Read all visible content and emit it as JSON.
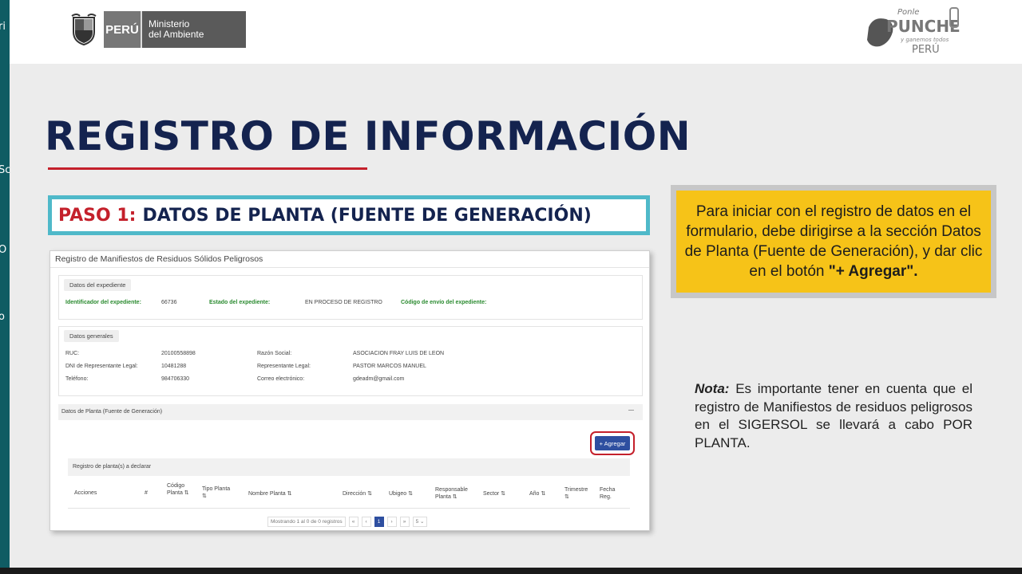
{
  "left_strip": {
    "chars": [
      "ri",
      "Sc",
      "O",
      "o"
    ]
  },
  "header": {
    "minam_country": "PERÚ",
    "minam_name_line1": "Ministerio",
    "minam_name_line2": "del Ambiente",
    "brand_logo_text_1": "Ponle",
    "brand_logo_text_2": "PUNCHE",
    "brand_logo_text_3": "y ganemos todos",
    "brand_logo_text_4": "PERÚ"
  },
  "slide": {
    "title": "REGISTRO DE INFORMACIÓN",
    "paso_prefix": "PASO 1:",
    "paso_text": "DATOS DE PLANTA (FUENTE DE GENERACIÓN)",
    "info_line1": "Para iniciar con el registro de datos en el formulario, debe dirigirse a la sección Datos de Planta (Fuente de Generación), y dar clic en el botón",
    "info_bold": "\"+ Agregar\".",
    "note_label": "Nota:",
    "note_text": "Es importante tener en cuenta que el registro de Manifiestos de residuos peligrosos en el SIGERSOL se llevará a cabo POR PLANTA."
  },
  "screenshot": {
    "title": "Registro de Manifiestos de Residuos Sólidos Peligrosos",
    "expediente": {
      "chip": "Datos del expediente",
      "id_label": "Identificador del expediente:",
      "id_value": "66736",
      "estado_label": "Estado del expediente:",
      "estado_value": "EN PROCESO DE REGISTRO",
      "codigo_label": "Código de envío del expediente:"
    },
    "generales": {
      "chip": "Datos generales",
      "ruc_label": "RUC:",
      "ruc_value": "20100558898",
      "razon_label": "Razón Social:",
      "razon_value": "ASOCIACION FRAY LUIS DE LEON",
      "dni_label": "DNI de Representante Legal:",
      "dni_value": "10481288",
      "rep_label": "Representante Legal:",
      "rep_value": "PASTOR MARCOS MANUEL",
      "tel_label": "Teléfono:",
      "tel_value": "984706330",
      "correo_label": "Correo electrónico:",
      "correo_value": "gdeadm@gmail.com"
    },
    "planta": {
      "header": "Datos de Planta (Fuente de Generación)",
      "collapse": "—",
      "agregar": "+ Agregar",
      "registro_header": "Registro de planta(s) a declarar",
      "columns": [
        "Acciones",
        "#",
        "Código Planta ⇅",
        "Tipo Planta ⇅",
        "Nombre Planta ⇅",
        "Dirección ⇅",
        "Ubigeo ⇅",
        "Responsable Planta ⇅",
        "Sector ⇅",
        "Año ⇅",
        "Trimestre ⇅",
        "Fecha Reg."
      ]
    },
    "pagination": {
      "summary": "Mostrando 1 al 0 de 0 registros",
      "first": "«",
      "prev": "‹",
      "page": "1",
      "next": "›",
      "last": "»",
      "per_page": "5 ⌄"
    }
  }
}
